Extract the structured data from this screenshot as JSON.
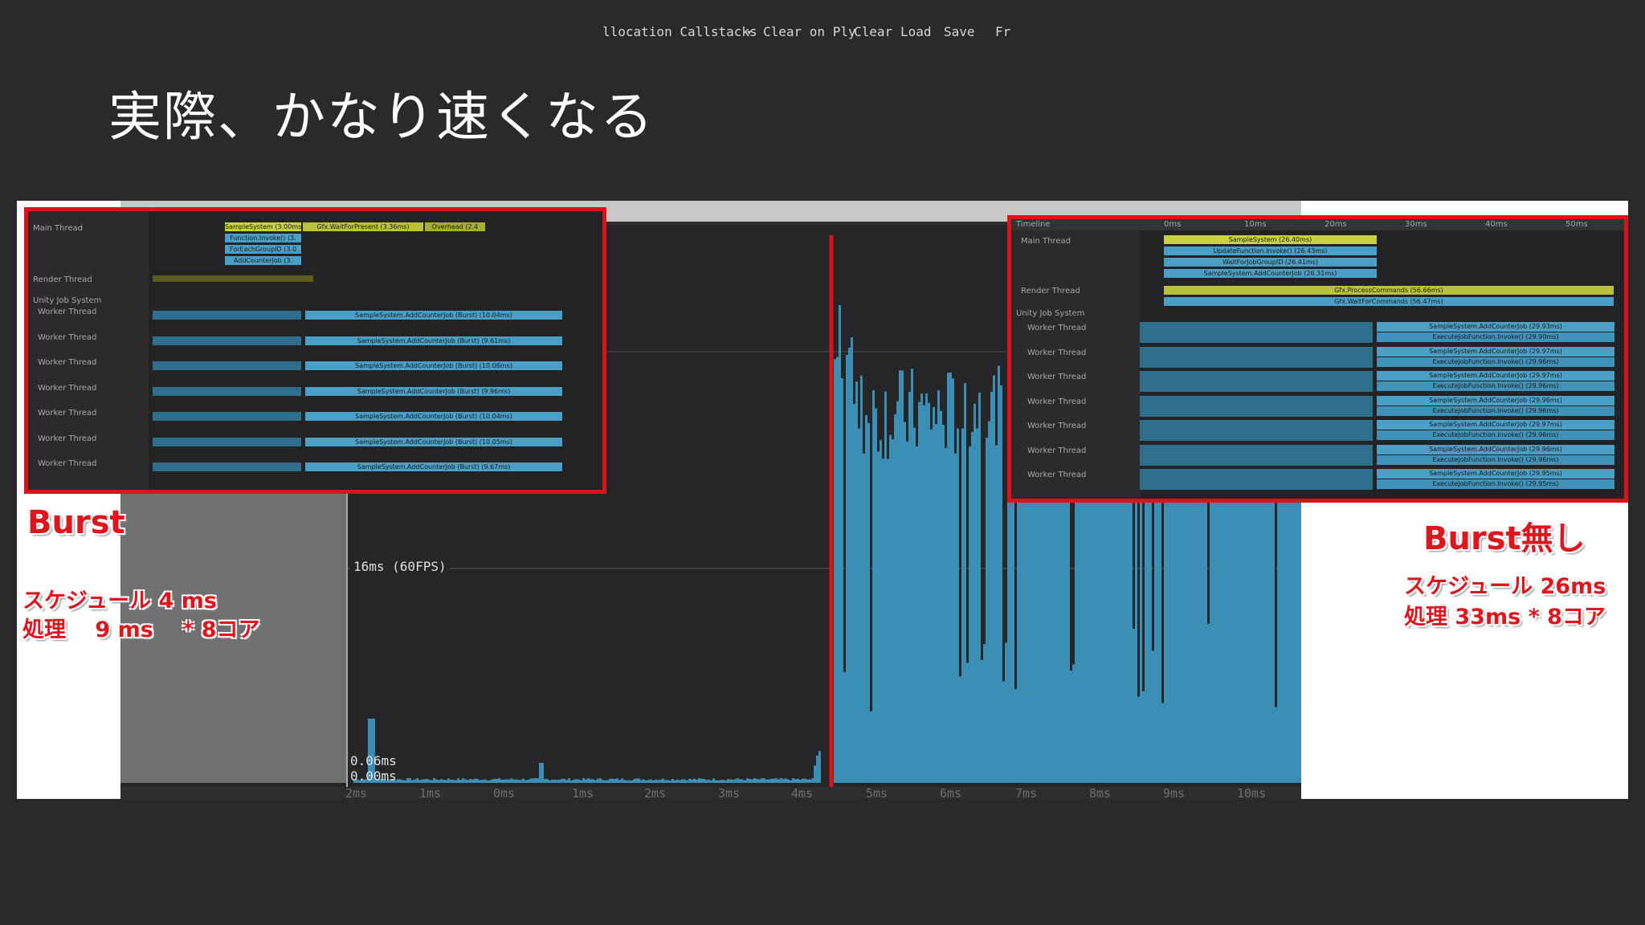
{
  "slide": {
    "title": "実際、かなり速くなる"
  },
  "toolbar": {
    "allocation_label": "llocation Callstacks",
    "dropdown_arrow": "▾",
    "clear_on_play_label": "Clear on Ply",
    "clear_label": "Clear",
    "load_label": "Load",
    "save_label": "Save",
    "frame_label": "Fr"
  },
  "chart": {
    "fps_label": "16ms (60FPS)",
    "ms_top_label": "0.06ms",
    "ms_bottom_label": "0.00ms",
    "ticks": [
      "2ms",
      "1ms",
      "0ms",
      "1ms",
      "2ms",
      "3ms",
      "4ms",
      "5ms",
      "6ms",
      "7ms",
      "8ms",
      "9ms",
      "10ms"
    ],
    "bar_color": "#3b8fb4"
  },
  "burst_panel": {
    "threads": {
      "main": "Main Thread",
      "render": "Render Thread",
      "jobs": "Unity Job System",
      "worker": "Worker Thread"
    },
    "main_bars": [
      "SampleSystem (3.00ms)",
      "Gfx.WaitForPresent (3.36ms)",
      "Overhead (2.4",
      "Function.Invoke() (3.",
      "ForEachGroupID (3.0",
      "AddCounterJob (3."
    ],
    "worker_bars": [
      "SampleSystem.AddCounterJob (Burst) (10.04ms)",
      "SampleSystem.AddCounterJob (Burst) (9.61ms)",
      "SampleSystem.AddCounterJob (Burst) (10.06ms)",
      "SampleSystem.AddCounterJob (Burst) (9.96ms)",
      "SampleSystem.AddCounterJob (Burst) (10.04ms)",
      "SampleSystem.AddCounterJob (Burst) (10.05ms)",
      "SampleSystem.AddCounterJob (Burst) (9.67ms)"
    ]
  },
  "noburst_panel": {
    "header": {
      "timeline": "Timeline",
      "ticks": [
        "0ms",
        "10ms",
        "20ms",
        "30ms",
        "40ms",
        "50ms"
      ]
    },
    "threads": {
      "main": "Main Thread",
      "render": "Render Thread",
      "jobs": "Unity Job System",
      "worker": "Worker Thread"
    },
    "main_bars": [
      "SampleSystem (26.40ms)",
      "UpdateFunction.Invoke() (26.43ms)",
      "WaitForJobGroupID (26.41ms)",
      "SampleSystem.AddCounterJob (26.31ms)"
    ],
    "render_bars": [
      "Gfx.ProcessCommands (56.66ms)",
      "Gfx.WaitForCommands (56.47ms)"
    ],
    "worker_bars": [
      [
        "SampleSystem.AddCounterJob (29.93ms)",
        "ExecuteJobFunction.Invoke() (29.90ms)"
      ],
      [
        "SampleSystem.AddCounterJob (29.97ms)",
        "ExecuteJobFunction.Invoke() (29.96ms)"
      ],
      [
        "SampleSystem.AddCounterJob (29.97ms)",
        "ExecuteJobFunction.Invoke() (29.96ms)"
      ],
      [
        "SampleSystem.AddCounterJob (29.96ms)",
        "ExecuteJobFunction.Invoke() (29.96ms)"
      ],
      [
        "SampleSystem.AddCounterJob (29.97ms)",
        "ExecuteJobFunction.Invoke() (29.96ms)"
      ],
      [
        "SampleSystem.AddCounterJob (29.96ms)",
        "ExecuteJobFunction.Invoke() (29.96ms)"
      ],
      [
        "SampleSystem.AddCounterJob (29.95ms)",
        "ExecuteJobFunction.Invoke() (29.95ms)"
      ]
    ]
  },
  "annotations": {
    "burst_title": "Burst",
    "burst_schedule": "スケジュール 4 ms",
    "burst_process": "処理　 9 ms　 * 8コア",
    "noburst_title": "Burst無し",
    "noburst_schedule": "スケジュール 26ms",
    "noburst_process": "処理 33ms * 8コア"
  },
  "colors": {
    "highlight_red": "#d9141b",
    "profiler_bg": "#262628",
    "worker_blue": "#4a9fc6",
    "main_yellow": "#b9c23a"
  }
}
